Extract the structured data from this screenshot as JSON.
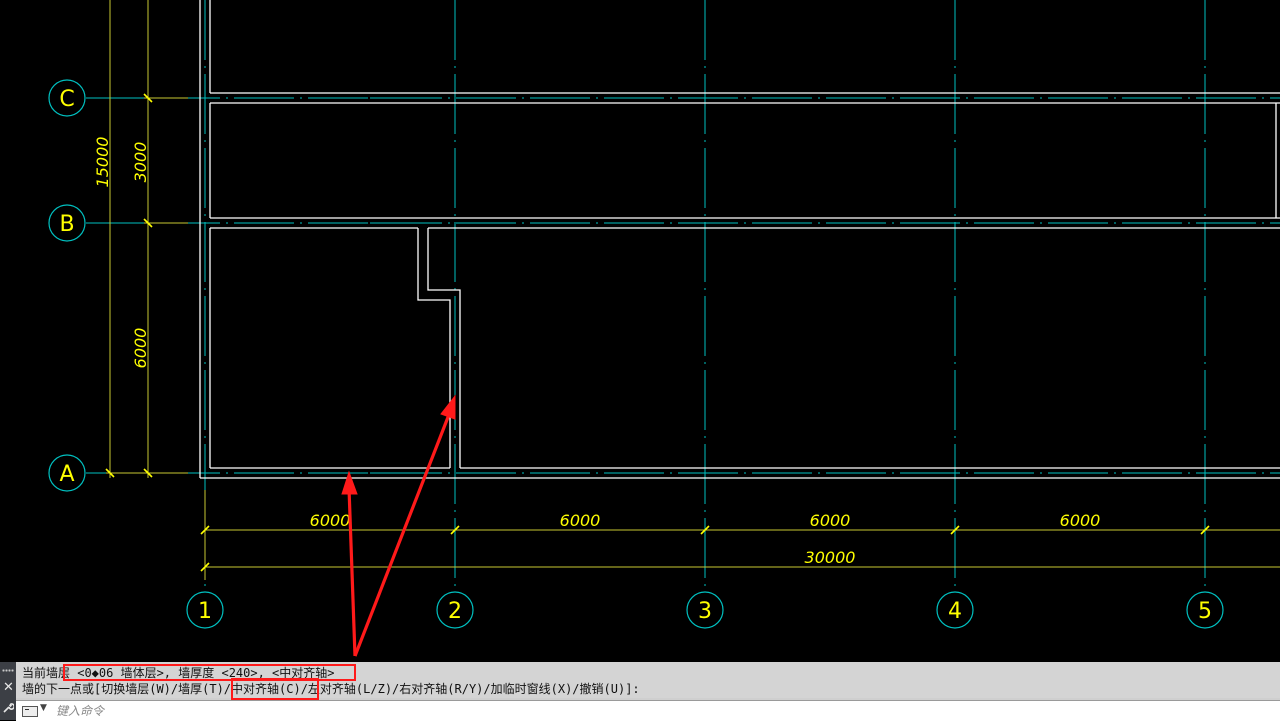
{
  "drawing": {
    "colors": {
      "background": "#000000",
      "wall": "#ffffff",
      "axis_line": "#00c0c0",
      "dimension": "#ffff00",
      "dimension_line": "#c8c832",
      "bubble": "#00c0c0",
      "annotation": "#ff1a1a"
    },
    "row_bubbles": [
      "C",
      "B",
      "A"
    ],
    "column_bubbles": [
      "1",
      "2",
      "3",
      "4",
      "5"
    ],
    "vertical_dims": {
      "overall": "15000",
      "cb": "3000",
      "ba": "6000"
    },
    "horizontal_dims": {
      "spans": [
        "6000",
        "6000",
        "6000",
        "6000"
      ],
      "total": "30000"
    }
  },
  "command_line": {
    "line1": "当前墙层 <0◆06 墙体层>, 墙厚度 <240>, <中对齐轴>",
    "line2": "墙的下一点或[切换墙层(W)/墙厚(T)/中对齐轴(C)/左对齐轴(L/Z)/右对齐轴(R/Y)/加临时窗线(X)/撤销(U)]:",
    "input_placeholder": "键入命令",
    "close_glyph": "✕",
    "wrench_glyph": "🔧",
    "icons": [
      "grip-icon",
      "close-icon",
      "wrench-icon",
      "command-prompt-icon",
      "dropdown-caret-icon"
    ]
  }
}
